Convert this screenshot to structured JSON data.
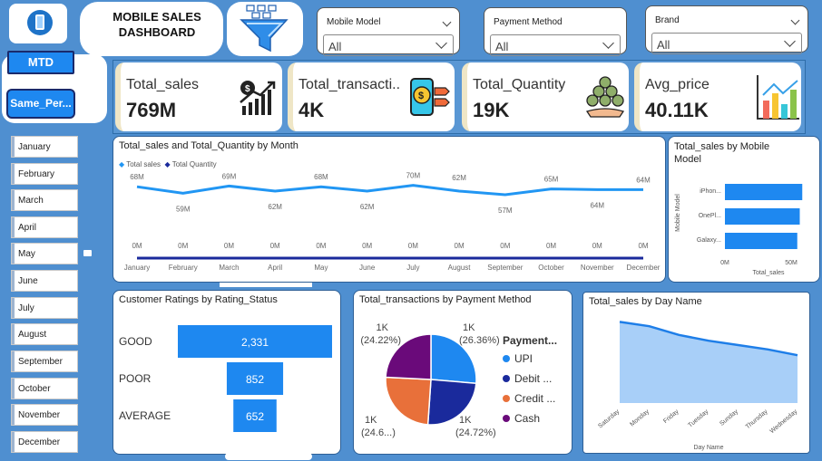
{
  "header": {
    "title": "MOBILE SALES DASHBOARD",
    "icons": [
      "phone-icon",
      "funnel-filter-icon"
    ]
  },
  "slicers": [
    {
      "label": "Mobile Model",
      "value": "All"
    },
    {
      "label": "Payment Method",
      "value": "All"
    },
    {
      "label": "Brand",
      "value": "All"
    }
  ],
  "buttons": {
    "mtd": "MTD",
    "same_period": "Same_Per..."
  },
  "months": [
    "January",
    "February",
    "March",
    "April",
    "May",
    "June",
    "July",
    "August",
    "September",
    "October",
    "November",
    "December"
  ],
  "kpis": [
    {
      "title": "Total_sales",
      "value": "769M",
      "icon": "money-growth-icon"
    },
    {
      "title": "Total_transacti...",
      "value": "4K",
      "icon": "mobile-payment-icon"
    },
    {
      "title": "Total_Quantity",
      "value": "19K",
      "icon": "coins-hand-icon"
    },
    {
      "title": "Avg_price",
      "value": "40.11K",
      "icon": "bar-chart-icon"
    }
  ],
  "colors": {
    "primary_blue": "#1e88f0",
    "dark_navy": "#1a2a9c",
    "orange": "#e8703a",
    "purple": "#6a0a7a",
    "area_blue": "#1e7ee8",
    "background": "#4f8fd0"
  },
  "chart_data": [
    {
      "type": "line",
      "title": "Total_sales and Total_Quantity by Month",
      "categories": [
        "January",
        "February",
        "March",
        "April",
        "May",
        "June",
        "July",
        "August",
        "September",
        "October",
        "November",
        "December"
      ],
      "series": [
        {
          "name": "Total sales",
          "values": [
            68,
            59,
            69,
            62,
            68,
            62,
            70,
            62,
            57,
            65,
            64,
            64
          ],
          "labels": [
            "68M",
            "59M",
            "69M",
            "62M",
            "68M",
            "62M",
            "70M",
            "62M",
            "57M",
            "65M",
            "64M",
            "64M"
          ]
        },
        {
          "name": "Total Quantity",
          "values": [
            0,
            0,
            0,
            0,
            0,
            0,
            0,
            0,
            0,
            0,
            0,
            0
          ],
          "labels": [
            "0M",
            "0M",
            "0M",
            "0M",
            "0M",
            "0M",
            "0M",
            "0M",
            "0M",
            "0M",
            "0M",
            "0M"
          ]
        }
      ]
    },
    {
      "type": "bar",
      "title": "Total_sales by Mobile Model",
      "categories": [
        "iPhon...",
        "OnePl...",
        "Galaxy..."
      ],
      "values": [
        62,
        60,
        58
      ],
      "xlabel": "Total_sales",
      "ylabel": "Mobile Model",
      "xticks": [
        "0M",
        "50M"
      ]
    },
    {
      "type": "bar",
      "title": "Customer Ratings by Rating_Status",
      "categories": [
        "GOOD",
        "POOR",
        "AVERAGE"
      ],
      "values": [
        2331,
        852,
        652
      ],
      "labels": [
        "2,331",
        "852",
        "652"
      ]
    },
    {
      "type": "pie",
      "title": "Total_transactions by Payment Method",
      "legend_title": "Payment...",
      "slices": [
        {
          "name": "UPI",
          "value": 26.36,
          "label": "1K",
          "pct": "(26.36%)"
        },
        {
          "name": "Debit ...",
          "value": 24.72,
          "label": "1K",
          "pct": "(24.72%)"
        },
        {
          "name": "Credit ...",
          "value": 24.7,
          "label": "1K",
          "pct": "(24.6...)"
        },
        {
          "name": "Cash",
          "value": 24.22,
          "label": "1K",
          "pct": "(24.22%)"
        }
      ]
    },
    {
      "type": "area",
      "title": "Total_sales by Day Name",
      "categories": [
        "Saturday",
        "Monday",
        "Friday",
        "Tuesday",
        "Sunday",
        "Thursday",
        "Wednesday"
      ],
      "values": [
        116,
        113,
        107,
        103,
        100,
        97,
        93
      ],
      "xlabel": "Day Name"
    }
  ]
}
